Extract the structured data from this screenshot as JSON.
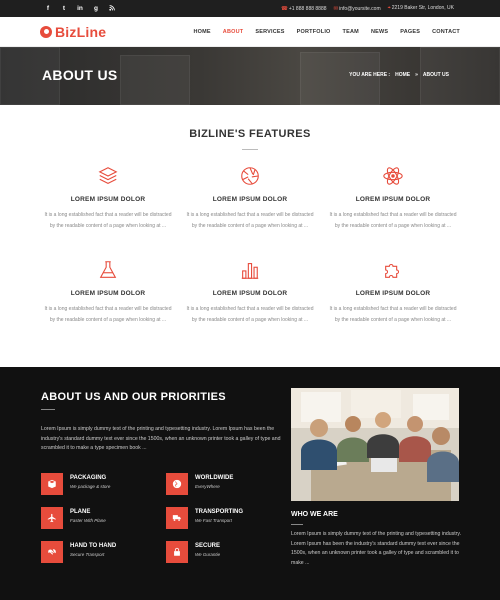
{
  "topbar": {
    "socials": [
      "f",
      "t",
      "in",
      "g",
      "rss"
    ],
    "phone": "+1 888 888 8888",
    "email": "info@yoursite.com",
    "address": "2219 Baker Str, London, UK"
  },
  "brand": {
    "name": "BizLine"
  },
  "nav": {
    "items": [
      "HOME",
      "ABOUT",
      "SERVICES",
      "PORTFOLIO",
      "TEAM",
      "NEWS",
      "PAGES",
      "CONTACT"
    ],
    "active": "ABOUT"
  },
  "hero": {
    "title": "ABOUT US",
    "crumb_prefix": "YOU ARE HERE :",
    "crumb_home": "HOME",
    "crumb_sep": "»",
    "crumb_current": "ABOUT US"
  },
  "features": {
    "title": "BIZLINE'S FEATURES",
    "items": [
      {
        "icon": "layers-icon",
        "title": "LOREM IPSUM DOLOR",
        "text": "It is a long established fact that a reader will be distracted by the readable content of a page when looking at ..."
      },
      {
        "icon": "aperture-icon",
        "title": "LOREM IPSUM DOLOR",
        "text": "It is a long established fact that a reader will be distracted by the readable content of a page when looking at ..."
      },
      {
        "icon": "atom-icon",
        "title": "LOREM IPSUM DOLOR",
        "text": "It is a long established fact that a reader will be distracted by the readable content of a page when looking at ..."
      },
      {
        "icon": "flask-icon",
        "title": "LOREM IPSUM DOLOR",
        "text": "It is a long established fact that a reader will be distracted by the readable content of a page when looking at ..."
      },
      {
        "icon": "bar-chart-icon",
        "title": "LOREM IPSUM DOLOR",
        "text": "It is a long established fact that a reader will be distracted by the readable content of a page when looking at ..."
      },
      {
        "icon": "puzzle-icon",
        "title": "LOREM IPSUM DOLOR",
        "text": "It is a long established fact that a reader will be distracted by the readable content of a page when looking at ..."
      }
    ]
  },
  "about": {
    "title": "ABOUT US AND OUR PRIORITIES",
    "text": "Lorem Ipsum is simply dummy text of the printing and typesetting industry. Lorem Ipsum has been the industry's standard dummy text ever since the 1500s, when an unknown printer took a galley of type and scrambled it to make a type specimen book ...",
    "services": [
      {
        "icon": "box-icon",
        "title": "PACKAGING",
        "sub": "We package & store"
      },
      {
        "icon": "globe-icon",
        "title": "WORLDWIDE",
        "sub": "EveryWhere"
      },
      {
        "icon": "plane-icon",
        "title": "PLANE",
        "sub": "Faster With Plane"
      },
      {
        "icon": "truck-icon",
        "title": "TRANSPORTING",
        "sub": "We Fast Transport"
      },
      {
        "icon": "handshake-icon",
        "title": "HAND TO HAND",
        "sub": "Secure Transport"
      },
      {
        "icon": "lock-icon",
        "title": "SECURE",
        "sub": "We Gurantie"
      }
    ],
    "who_title": "WHO WE ARE",
    "who_text": "Lorem Ipsum is simply dummy text of the printing and typesetting industry. Lorem Ipsum has been the industry's standard dummy text ever since the 1500s, when an unknown printer took a galley of type and scrambled it to make ..."
  },
  "colors": {
    "accent": "#e74c3c",
    "dark": "#111111",
    "topbar": "#1f1f1f"
  }
}
